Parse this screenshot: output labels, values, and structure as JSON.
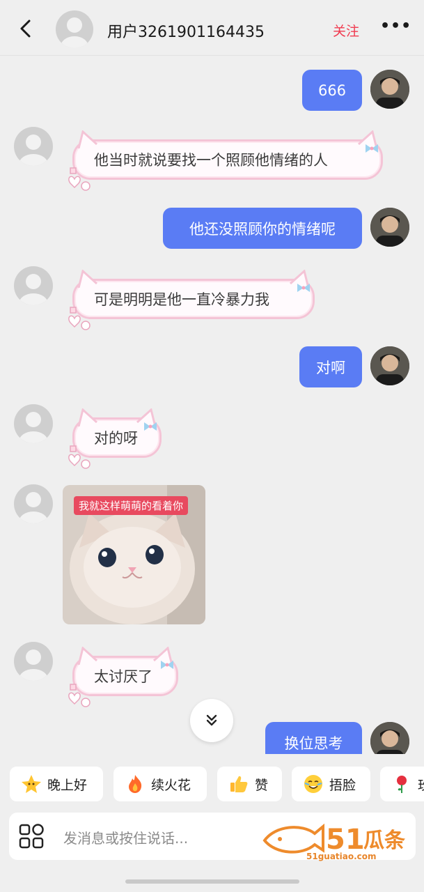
{
  "header": {
    "title": "用户3261901164435",
    "follow_label": "关注",
    "more_label": "•••",
    "back_icon": "chevron-left-icon"
  },
  "messages": [
    {
      "side": "right",
      "type": "text",
      "text": "666"
    },
    {
      "side": "left",
      "type": "text",
      "text": "他当时就说要找一个照顾他情绪的人"
    },
    {
      "side": "right",
      "type": "text",
      "text": "他还没照顾你的情绪呢"
    },
    {
      "side": "left",
      "type": "text",
      "text": "可是明明是他一直冷暴力我"
    },
    {
      "side": "right",
      "type": "text",
      "text": "对啊"
    },
    {
      "side": "left",
      "type": "text",
      "text": "对的呀"
    },
    {
      "side": "left",
      "type": "sticker",
      "caption": "我就这样萌萌的看着你"
    },
    {
      "side": "left",
      "type": "text",
      "text": "太讨厌了"
    },
    {
      "side": "right",
      "type": "text",
      "text": "换位思考"
    }
  ],
  "quick_replies": [
    {
      "label": "晚上好",
      "icon": "star-face-icon"
    },
    {
      "label": "续火花",
      "icon": "flame-icon"
    },
    {
      "label": "赞",
      "icon": "thumbs-up-icon"
    },
    {
      "label": "捂脸",
      "icon": "facepalm-emoji-icon"
    },
    {
      "label": "玫",
      "icon": "rose-icon"
    }
  ],
  "input": {
    "placeholder": "发消息或按住说话..."
  },
  "watermark": {
    "brand": "51瓜条",
    "url": "51guatiao.com"
  },
  "colors": {
    "self_bubble": "#5a7cf4",
    "follow_red": "#f03a4f",
    "pink_border": "#f4c4d6",
    "background": "#efefef"
  }
}
